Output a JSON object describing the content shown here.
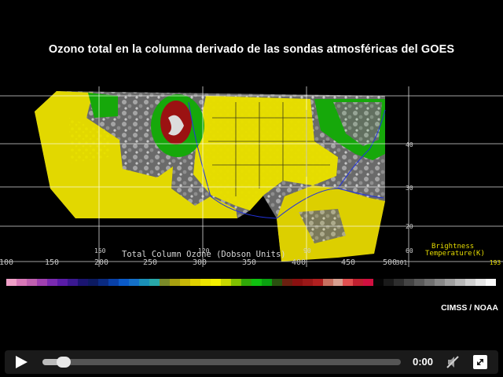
{
  "title": "Ozono total en la columna derivado de las sondas atmosféricas del GOES",
  "credit": "CIMSS / NOAA",
  "map": {
    "colorbar_title": "Total Column Ozone (Dobson Units)",
    "brightness_label_1": "Brightness",
    "brightness_label_2": "Temperature(K)",
    "longitude_labels": [
      "150",
      "120",
      "90",
      "60"
    ],
    "latitude_labels": [
      "40",
      "30",
      "20"
    ],
    "colorbar_ticks": [
      "100",
      "150",
      "200",
      "250",
      "300",
      "350",
      "400",
      "450",
      "500"
    ],
    "bt_left_tick": "301",
    "bt_right_tick": "193",
    "colors": {
      "ozone_low": "#e8e000",
      "ozone_mid": "#16a80a",
      "ozone_high": "#9b1212",
      "grid": "#ffffff",
      "border": "#2233dd"
    }
  },
  "player": {
    "time": "0:00",
    "progress": 0.06,
    "icons": {
      "play": "play-icon",
      "mute": "mute-icon",
      "fullscreen": "fullscreen-icon"
    }
  }
}
